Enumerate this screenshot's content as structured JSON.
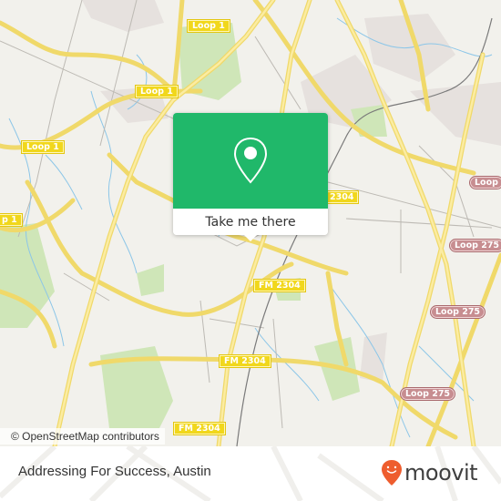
{
  "map": {
    "attribution": "© OpenStreetMap contributors",
    "road_labels": [
      {
        "id": "loop1-a",
        "text": "Loop 1",
        "style": "yellow"
      },
      {
        "id": "loop1-b",
        "text": "Loop 1",
        "style": "yellow"
      },
      {
        "id": "loop1-c",
        "text": "Loop 1",
        "style": "yellow"
      },
      {
        "id": "loop1-d",
        "text": "p 1",
        "style": "yellow"
      },
      {
        "id": "fm2304-a",
        "text": "2304",
        "style": "yellow"
      },
      {
        "id": "fm2304-b",
        "text": "FM 2304",
        "style": "yellow"
      },
      {
        "id": "fm2304-c",
        "text": "FM 2304",
        "style": "yellow"
      },
      {
        "id": "fm2304-d",
        "text": "FM 2304",
        "style": "yellow"
      },
      {
        "id": "loop275-a",
        "text": "Loop",
        "style": "pink"
      },
      {
        "id": "loop275-b",
        "text": "Loop 275",
        "style": "pink"
      },
      {
        "id": "loop275-c",
        "text": "Loop 275",
        "style": "pink"
      },
      {
        "id": "loop275-d",
        "text": "Loop 275",
        "style": "pink"
      }
    ],
    "colors": {
      "land": "#f2f1ec",
      "major_road": "#f8e27a",
      "minor_road": "#bdbab4",
      "water": "#8cc6e8",
      "park": "#cfe6b8",
      "urban": "#e6e1de",
      "rail": "#7a7a7a"
    }
  },
  "popup": {
    "icon": "map-pin-icon",
    "action_label": "Take me there",
    "accent": "#20b86a"
  },
  "footer": {
    "place_name": "Addressing For Success, Austin",
    "brand": "moovit",
    "brand_icon": "moovit-smiley-pin-icon",
    "brand_color": "#ee5d2e"
  }
}
